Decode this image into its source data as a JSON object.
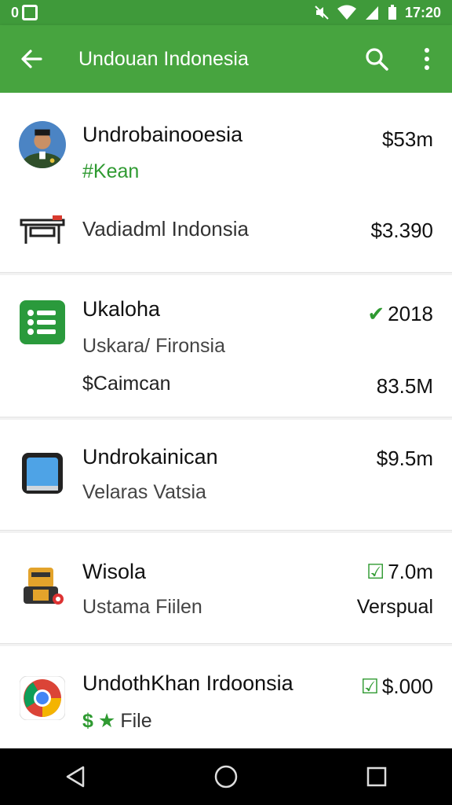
{
  "status_bar": {
    "left_icons": [
      "0",
      "□"
    ],
    "time": "17:20"
  },
  "app_bar": {
    "title": "Undouan Indonesia",
    "icons": [
      "back-arrow-icon",
      "search-icon",
      "more-vert-icon"
    ]
  },
  "items": [
    {
      "primary": "Undrobainooesia",
      "secondary": "#Kean",
      "right": "$53m",
      "sub_primary": "Vadiadml Indonsia",
      "sub_right": "$3.390",
      "icon": "avatar",
      "sub_icon": "desk-icon"
    },
    {
      "primary": "Ukaloha",
      "secondary": "Uskara/ Fironsia",
      "tertiary": "$Caimcan",
      "right": "2018",
      "right_tertiary": "83.5M",
      "icon": "list-app-icon"
    },
    {
      "primary": "Undrokainican",
      "secondary": "Velaras Vatsia",
      "right": "$9.5m",
      "icon": "tablet-icon"
    },
    {
      "primary": "Wisola",
      "secondary": "Ustama Fiilen",
      "right": "7.0m",
      "right_secondary": "Verspual",
      "icon": "robot-icon"
    },
    {
      "primary": "UndothKhan Irdoonsia",
      "secondary": "File",
      "secondary_prefix": "$",
      "right": "$.000",
      "icon": "chrome-icon"
    }
  ],
  "nav_bar": {
    "icons": [
      "back-triangle-icon",
      "home-circle-icon",
      "recents-square-icon"
    ]
  },
  "colors": {
    "app_bar": "#47a43f",
    "accent_green": "#2f9a31"
  }
}
